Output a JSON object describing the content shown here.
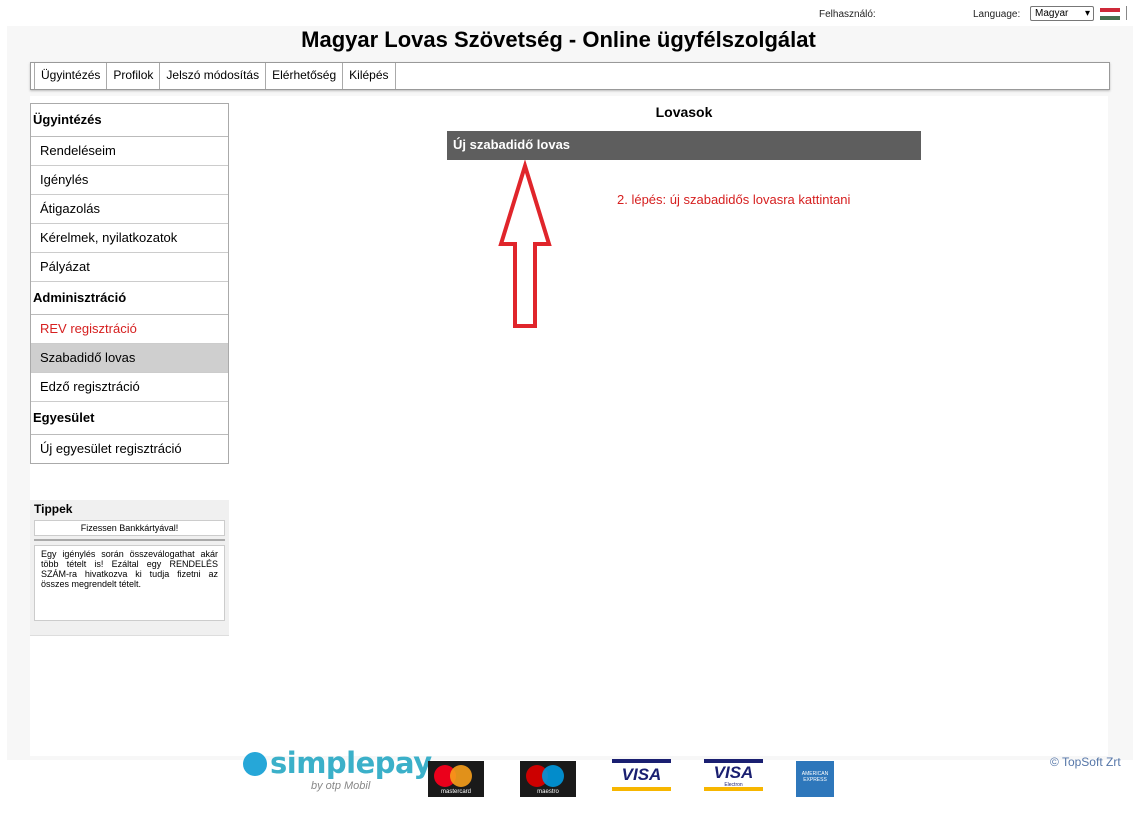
{
  "header": {
    "user_label": "Felhasználó:",
    "language_label": "Language:",
    "language_value": "Magyar",
    "title": "Magyar Lovas Szövetség - Online ügyfélszolgálat"
  },
  "nav": {
    "tabs": [
      {
        "label": "Ügyintézés"
      },
      {
        "label": "Profilok"
      },
      {
        "label": "Jelszó módosítás"
      },
      {
        "label": "Elérhetőség"
      },
      {
        "label": "Kilépés"
      }
    ]
  },
  "sidebar": {
    "sections": [
      {
        "title": "Ügyintézés",
        "items": [
          "Rendeléseim",
          "Igénylés",
          "Átigazolás",
          "Kérelmek, nyilatkozatok",
          "Pályázat"
        ]
      },
      {
        "title": "Adminisztráció",
        "items": [
          "REV regisztráció",
          "Szabadidő lovas",
          "Edző regisztráció"
        ]
      },
      {
        "title": "Egyesület",
        "items": [
          "Új egyesület regisztráció"
        ]
      }
    ]
  },
  "tips": {
    "title": "Tippek",
    "pay_text": "Fizessen Bankkártyával!",
    "text": "Egy igénylés során összeválogathat akár több tételt is! Ezáltal egy RENDELÉS SZÁM-ra hivatkozva ki tudja fizetni az összes megrendelt tételt."
  },
  "main": {
    "section_title": "Lovasok",
    "new_horse_button": "Új szabadidő lovas",
    "annotation": "2. lépés: új szabadidős lovasra kattintani"
  },
  "footer": {
    "simplepay_text": "simplepay",
    "simplepay_by": "by otp Mobil",
    "mastercard_label": "mastercard",
    "maestro_label": "maestro",
    "visa_label": "VISA",
    "visa_electron_label": "VISA",
    "visa_electron_sub": "Electron",
    "amex_label": "AMERICAN EXPRESS",
    "copyright": "© TopSoft Zrt"
  },
  "colors": {
    "accent_red": "#d62020",
    "active_item_bg": "#cfcfcf",
    "button_bg": "#5e5e5e",
    "simplepay_blue": "#3bb0c9"
  }
}
